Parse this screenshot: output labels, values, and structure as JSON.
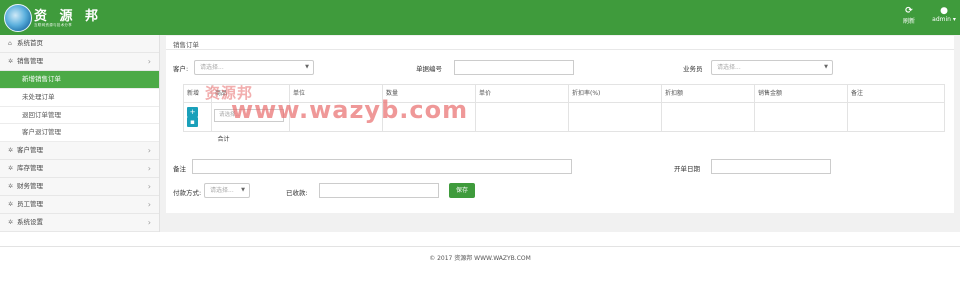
{
  "header": {
    "brand": "资 源 邦",
    "brand_sub": "互联网资源与技术分享",
    "refresh_label": "刷新",
    "user_label": "admin ▾",
    "refresh_icon": "refresh-icon",
    "user_icon": "user-icon",
    "accent": "#3f9b3c"
  },
  "sidebar": {
    "items": [
      {
        "label": "系统首页",
        "icon": "home-icon"
      },
      {
        "label": "销售管理",
        "icon": "gear-icon"
      },
      {
        "label": "客户管理",
        "icon": "gear-icon"
      },
      {
        "label": "库存管理",
        "icon": "gear-icon"
      },
      {
        "label": "财务管理",
        "icon": "gear-icon"
      },
      {
        "label": "员工管理",
        "icon": "gear-icon"
      },
      {
        "label": "系统设置",
        "icon": "gear-icon"
      }
    ],
    "sub_items": [
      "新增销售订单",
      "未处理订单",
      "退回订单管理",
      "客户退订管理"
    ]
  },
  "form": {
    "title": "销售订单",
    "customer_label": "客户:",
    "customer_placeholder": "请选择...",
    "order_no_label": "单据编号",
    "salesman_label": "业务员",
    "salesman_placeholder": "请选择...",
    "columns": [
      "新增",
      "商品",
      "单位",
      "数量",
      "单价",
      "折扣率(%)",
      "折扣额",
      "销售金额",
      "备注"
    ],
    "product_placeholder": "请选择...",
    "total_label": "合计",
    "remark_label": "备注",
    "open_date_label": "开单日期",
    "payment_label": "付款方式:",
    "payment_placeholder": "请选择...",
    "received_label": "已收款:",
    "save_label": "保存"
  },
  "footer": {
    "text": "© 2017 资源邦 WWW.WAZYB.COM"
  },
  "watermark": {
    "text": "www.wazyb.com",
    "text_cn": "资源邦"
  }
}
